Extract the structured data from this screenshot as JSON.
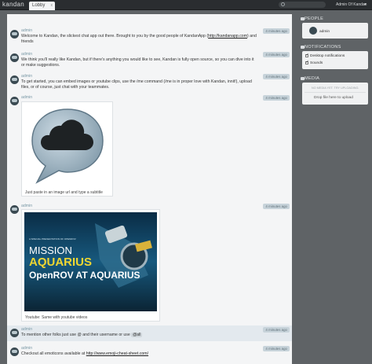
{
  "app": {
    "logo": "kandan",
    "tab_label": "Lobby",
    "tab_close": "x",
    "user_label": "Admin Of Kandan",
    "user_caret": "▾"
  },
  "messages": [
    {
      "author": "admin",
      "time": "4 minutes ago",
      "text_before": "Welcome to Kandan, the slickest chat app out there. Brought to you by the good people of KandanApp (",
      "link": "http://kandanapp.com",
      "text_after": ") and friends"
    },
    {
      "author": "admin",
      "time": "4 minutes ago",
      "text": "We think you'll really like Kandan, but if there's anything you would like to see, Kandan is fully open source, so you can dive into it or make suggestions."
    },
    {
      "author": "admin",
      "time": "4 minutes ago",
      "text": "To get started, you can embed images or youtube clips, use the /me command (/me is in proper love with Kandan, innit!), upload files, or of course, just chat with your teammates."
    },
    {
      "author": "admin",
      "time": "4 minutes ago",
      "caption": "Just paste in an image url and type a subtitle"
    },
    {
      "author": "admin",
      "time": "4 minutes ago",
      "caption": "Youtube: Same with youtube videos",
      "video": {
        "top_text": "A SPECIAL PRESENTATION OF OPENROV",
        "line1": "MISSION",
        "line2": "AQUARIUS",
        "line3": "OpenROV AT AQUARIUS"
      }
    },
    {
      "author": "admin",
      "time": "4 minutes ago",
      "text": "To mention other folks just use @ and their username or use",
      "mention": "@all"
    },
    {
      "author": "admin",
      "time": "4 minutes ago",
      "text": "Checkout all emoticons available at",
      "link": "http://www.emoji-cheat-sheet.com/"
    }
  ],
  "sidebar": {
    "people": {
      "title": "PEOPLE",
      "members": [
        "admin"
      ]
    },
    "notifications": {
      "title": "NOTIFICATIONS",
      "items": [
        "Desktop notifications",
        "Sounds"
      ]
    },
    "media": {
      "title": "MEDIA",
      "empty": "NO MEDIA YET. TRY UPLOADING.",
      "drop": "Drop file here to upload"
    }
  }
}
